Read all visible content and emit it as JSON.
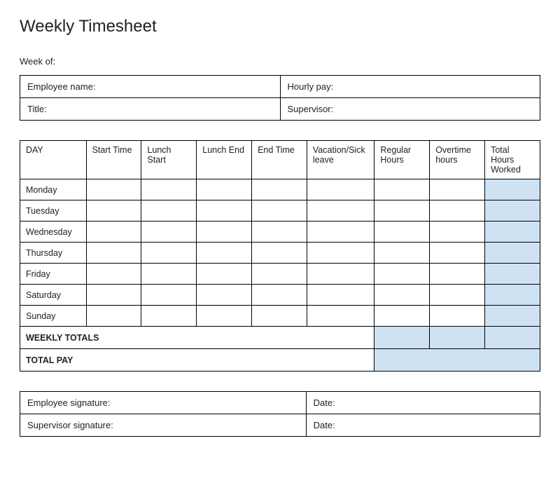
{
  "title": "Weekly Timesheet",
  "week_of_label": "Week of:",
  "info": {
    "employee_name_label": "Employee name:",
    "hourly_pay_label": "Hourly pay:",
    "title_label": "Title:",
    "supervisor_label": "Supervisor:"
  },
  "headers": {
    "day": "DAY",
    "start_time": "Start Time",
    "lunch_start": "Lunch Start",
    "lunch_end": "Lunch End",
    "end_time": "End Time",
    "vacation_sick": "Vacation/Sick leave",
    "regular_hours": "Regular Hours",
    "overtime_hours": "Overtime hours",
    "total_hours": "Total Hours Worked"
  },
  "days": {
    "mon": "Monday",
    "tue": "Tuesday",
    "wed": "Wednesday",
    "thu": "Thursday",
    "fri": "Friday",
    "sat": "Saturday",
    "sun": "Sunday"
  },
  "totals": {
    "weekly_totals_label": "WEEKLY TOTALS",
    "total_pay_label": "TOTAL PAY"
  },
  "sig": {
    "employee_sig_label": "Employee signature:",
    "supervisor_sig_label": "Supervisor signature:",
    "date_label": "Date:"
  },
  "colors": {
    "highlight": "#cfe2f3"
  }
}
